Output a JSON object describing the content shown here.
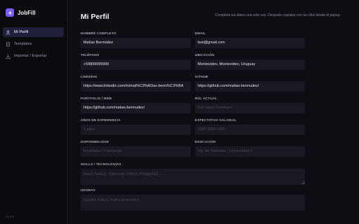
{
  "app": {
    "name": "JobFill",
    "version": "v1.0.0"
  },
  "nav": [
    {
      "label": "Mi Perfil",
      "icon": "user-icon",
      "active": true
    },
    {
      "label": "Templates",
      "icon": "document-icon",
      "active": false
    },
    {
      "label": "Importar / Exportar",
      "icon": "download-icon",
      "active": false
    }
  ],
  "page": {
    "title": "Mi Perfil",
    "subtitle": "Completá tus datos una sola vez. Después copialos con un click desde el popup."
  },
  "fields": {
    "nombre": {
      "label": "Nombre completo",
      "value": "Matías Bermúdez",
      "placeholder": ""
    },
    "email": {
      "label": "Email",
      "value": "test@gmail.com",
      "placeholder": ""
    },
    "telefono": {
      "label": "Teléfono",
      "value": "+59899999999",
      "placeholder": ""
    },
    "ubicacion": {
      "label": "Ubicación",
      "value": "Montevideo, Montevideo, Uruguay",
      "placeholder": ""
    },
    "linkedin": {
      "label": "LinkedIn",
      "value": "https://www.linkedin.com/in/mat%C3%ADas-berm%C3%BA",
      "placeholder": ""
    },
    "github": {
      "label": "GitHub",
      "value": "https://github.com/matias-bermudez/",
      "placeholder": ""
    },
    "portfolio": {
      "label": "Portfolio / Web",
      "value": "https://github.com/matias-bermudez/",
      "placeholder": ""
    },
    "rol": {
      "label": "Rol actual",
      "value": "",
      "placeholder": "Full Stack Developer"
    },
    "experiencia": {
      "label": "Años de experiencia",
      "value": "",
      "placeholder": "3 años"
    },
    "salario": {
      "label": "Expectativa salarial",
      "value": "",
      "placeholder": "2000-3000 USD"
    },
    "disponibilidad": {
      "label": "Disponibilidad",
      "value": "",
      "placeholder": "Inmediata / 2 semanas"
    },
    "educacion": {
      "label": "Educación",
      "value": "",
      "placeholder": "Ing. de Sistemas - Universidad X"
    },
    "skills": {
      "label": "Skills / Tecnologías",
      "value": "",
      "placeholder": "React, Node.js, TypeScript, Python, PostgreSQL..."
    },
    "idiomas": {
      "label": "Idiomas",
      "value": "",
      "placeholder": "Español (nativo), Inglés (avanzado)..."
    }
  },
  "colors": {
    "accent": "#7b5cff",
    "active_bg": "#221f3d",
    "input_bg": "#19191f",
    "background": "#0e0e12"
  }
}
